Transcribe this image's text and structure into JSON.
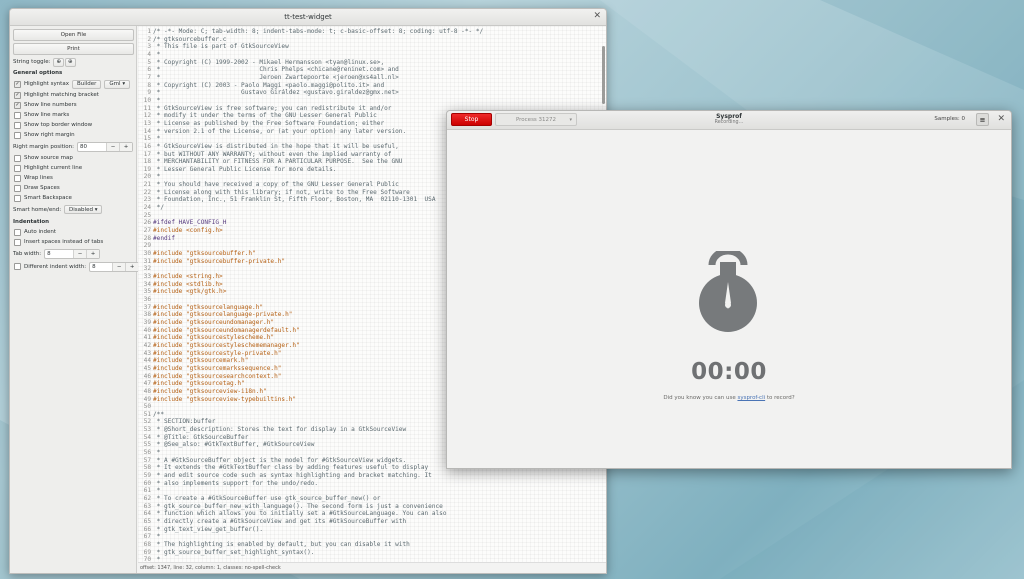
{
  "window1": {
    "title": "tt-test-widget",
    "buttons": {
      "open": "Open File",
      "print": "Print"
    },
    "string_toggle_label": "String toggle:",
    "general_header": "General options",
    "highlight_syntax": "Highlight syntax",
    "builder": "Builder",
    "lang_select": "Gml",
    "checks1": [
      {
        "label": "Highlight matching bracket",
        "on": "✓"
      },
      {
        "label": "Show line numbers",
        "on": "✓"
      },
      {
        "label": "Show line marks",
        "on": ""
      },
      {
        "label": "Show top border window",
        "on": ""
      },
      {
        "label": "Show right margin",
        "on": ""
      }
    ],
    "right_margin_label": "Right margin position:",
    "right_margin_value": "80",
    "checks2": [
      {
        "label": "Show source map",
        "on": ""
      },
      {
        "label": "Highlight current line",
        "on": ""
      },
      {
        "label": "Wrap lines",
        "on": ""
      },
      {
        "label": "Draw Spaces",
        "on": ""
      },
      {
        "label": "Smart Backspace",
        "on": ""
      }
    ],
    "smart_home_label": "Smart home/end:",
    "smart_home_value": "Disabled",
    "indent_header": "Indentation",
    "auto_indent": "Auto indent",
    "insert_spaces": "Insert spaces instead of tabs",
    "tab_width_label": "Tab width:",
    "tab_width_value": "8",
    "diff_indent_label": "Different indent width:",
    "diff_indent_value": "8",
    "minus": "−",
    "plus": "+",
    "status": "offset: 1347, line: 32, column: 1, classes: no-spell-check",
    "code_lines": [
      [
        "1",
        "/* -*- Mode: C; tab-width: 8; indent-tabs-mode: t; c-basic-offset: 8; coding: utf-8 -*- */",
        "c"
      ],
      [
        "2",
        "/* gtksourcebuffer.c",
        "c"
      ],
      [
        "3",
        " * This file is part of GtkSourceView",
        "c"
      ],
      [
        "4",
        " *",
        "c"
      ],
      [
        "5",
        " * Copyright (C) 1999-2002 - Mikael Hermansson <tyan@linux.se>,",
        "c"
      ],
      [
        "6",
        " *                           Chris Phelps <chicane@reninet.com> and",
        "c"
      ],
      [
        "7",
        " *                           Jeroen Zwartepoorte <jeroen@xs4all.nl>",
        "c"
      ],
      [
        "8",
        " * Copyright (C) 2003 - Paolo Maggi <paolo.maggi@polito.it> and",
        "c"
      ],
      [
        "9",
        " *                      Gustavo Giráldez <gustavo.giraldez@gmx.net>",
        "c"
      ],
      [
        "10",
        " *",
        "c"
      ],
      [
        "11",
        " * GtkSourceView is free software; you can redistribute it and/or",
        "c"
      ],
      [
        "12",
        " * modify it under the terms of the GNU Lesser General Public",
        "c"
      ],
      [
        "13",
        " * License as published by the Free Software Foundation; either",
        "c"
      ],
      [
        "14",
        " * version 2.1 of the License, or (at your option) any later version.",
        "c"
      ],
      [
        "15",
        " *",
        "c"
      ],
      [
        "16",
        " * GtkSourceView is distributed in the hope that it will be useful,",
        "c"
      ],
      [
        "17",
        " * but WITHOUT ANY WARRANTY; without even the implied warranty of",
        "c"
      ],
      [
        "18",
        " * MERCHANTABILITY or FITNESS FOR A PARTICULAR PURPOSE.  See the GNU",
        "c"
      ],
      [
        "19",
        " * Lesser General Public License for more details.",
        "c"
      ],
      [
        "20",
        " *",
        "c"
      ],
      [
        "21",
        " * You should have received a copy of the GNU Lesser General Public",
        "c"
      ],
      [
        "22",
        " * License along with this library; if not, write to the Free Software",
        "c"
      ],
      [
        "23",
        " * Foundation, Inc., 51 Franklin St, Fifth Floor, Boston, MA  02110-1301  USA",
        "c"
      ],
      [
        "24",
        " */",
        "c"
      ],
      [
        "25",
        "",
        "t"
      ],
      [
        "26",
        "#ifdef HAVE_CONFIG_H",
        "p"
      ],
      [
        "27",
        "#include <config.h>",
        "s"
      ],
      [
        "28",
        "#endif",
        "p"
      ],
      [
        "29",
        "",
        "t"
      ],
      [
        "30",
        "#include \"gtksourcebuffer.h\"",
        "s"
      ],
      [
        "31",
        "#include \"gtksourcebuffer-private.h\"",
        "s"
      ],
      [
        "32",
        "",
        "t"
      ],
      [
        "33",
        "#include <string.h>",
        "s"
      ],
      [
        "34",
        "#include <stdlib.h>",
        "s"
      ],
      [
        "35",
        "#include <gtk/gtk.h>",
        "s"
      ],
      [
        "36",
        "",
        "t"
      ],
      [
        "37",
        "#include \"gtksourcelanguage.h\"",
        "s"
      ],
      [
        "38",
        "#include \"gtksourcelanguage-private.h\"",
        "s"
      ],
      [
        "39",
        "#include \"gtksourceundomanager.h\"",
        "s"
      ],
      [
        "40",
        "#include \"gtksourceundomanagerdefault.h\"",
        "s"
      ],
      [
        "41",
        "#include \"gtksourcestylescheme.h\"",
        "s"
      ],
      [
        "42",
        "#include \"gtksourcestyleschememanager.h\"",
        "s"
      ],
      [
        "43",
        "#include \"gtksourcestyle-private.h\"",
        "s"
      ],
      [
        "44",
        "#include \"gtksourcemark.h\"",
        "s"
      ],
      [
        "45",
        "#include \"gtksourcemarkssequence.h\"",
        "s"
      ],
      [
        "46",
        "#include \"gtksourcesearchcontext.h\"",
        "s"
      ],
      [
        "47",
        "#include \"gtksourcetag.h\"",
        "s"
      ],
      [
        "48",
        "#include \"gtksourceview-i18n.h\"",
        "s"
      ],
      [
        "49",
        "#include \"gtksourceview-typebuiltins.h\"",
        "s"
      ],
      [
        "50",
        "",
        "t"
      ],
      [
        "51",
        "/**",
        "c"
      ],
      [
        "52",
        " * SECTION:buffer",
        "c"
      ],
      [
        "53",
        " * @Short_description: Stores the text for display in a GtkSourceView",
        "c"
      ],
      [
        "54",
        " * @Title: GtkSourceBuffer",
        "c"
      ],
      [
        "55",
        " * @See_also: #GtkTextBuffer, #GtkSourceView",
        "c"
      ],
      [
        "56",
        " *",
        "c"
      ],
      [
        "57",
        " * A #GtkSourceBuffer object is the model for #GtkSourceView widgets.",
        "c"
      ],
      [
        "58",
        " * It extends the #GtkTextBuffer class by adding features useful to display",
        "c"
      ],
      [
        "59",
        " * and edit source code such as syntax highlighting and bracket matching. It",
        "c"
      ],
      [
        "60",
        " * also implements support for the undo/redo.",
        "c"
      ],
      [
        "61",
        " *",
        "c"
      ],
      [
        "62",
        " * To create a #GtkSourceBuffer use gtk_source_buffer_new() or",
        "c"
      ],
      [
        "63",
        " * gtk_source_buffer_new_with_language(). The second form is just a convenience",
        "c"
      ],
      [
        "64",
        " * function which allows you to initially set a #GtkSourceLanguage. You can also",
        "c"
      ],
      [
        "65",
        " * directly create a #GtkSourceView and get its #GtkSourceBuffer with",
        "c"
      ],
      [
        "66",
        " * gtk_text_view_get_buffer().",
        "c"
      ],
      [
        "67",
        " *",
        "c"
      ],
      [
        "68",
        " * The highlighting is enabled by default, but you can disable it with",
        "c"
      ],
      [
        "69",
        " * gtk_source_buffer_set_highlight_syntax().",
        "c"
      ],
      [
        "70",
        " *",
        "c"
      ],
      [
        "71",
        " * # Undo/Redo",
        "c"
      ]
    ]
  },
  "window2": {
    "stop": "Stop",
    "process": "Process 31272",
    "title": "Sysprof",
    "subtitle": "Recording…",
    "samples": "Samples: 0",
    "menu_icon": "hamburger-icon",
    "timer": "00:00",
    "hint_before": "Did you know you can use ",
    "hint_link": "sysprof-cli",
    "hint_after": " to record?",
    "icon_color": "#777a7c"
  }
}
